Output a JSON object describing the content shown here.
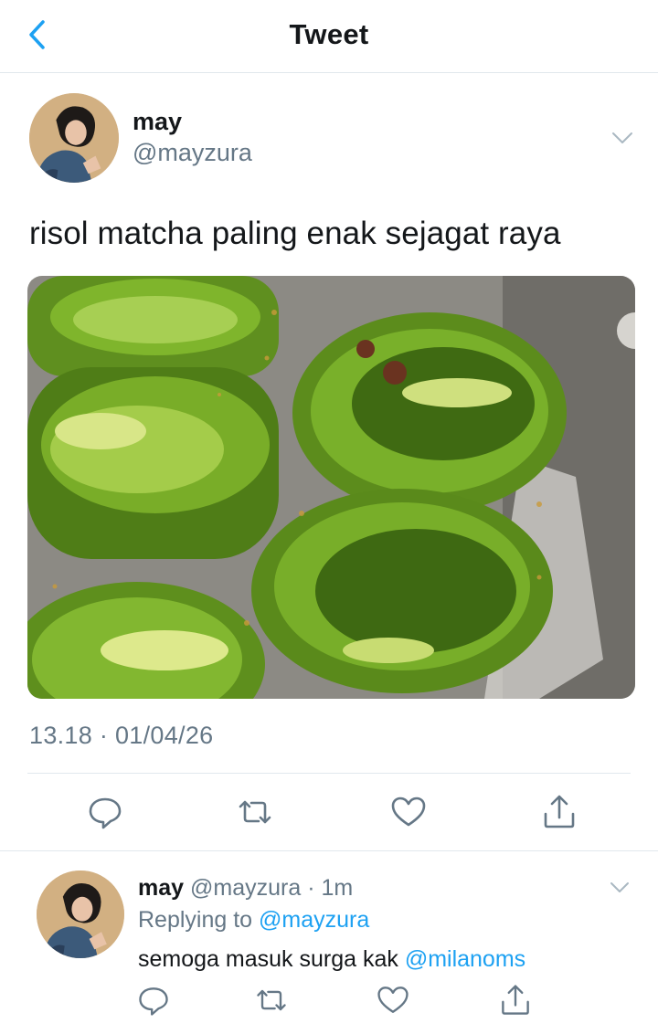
{
  "header": {
    "title": "Tweet",
    "back_icon": "chevron-left-icon"
  },
  "tweet": {
    "name": "may",
    "handle": "@mayzura",
    "text": "risol matcha paling enak sejagat raya",
    "image_subject": "fried green matcha rolls",
    "timestamp": "13.18 · 01/04/26",
    "actions": [
      "reply-icon",
      "retweet-icon",
      "like-icon",
      "share-icon"
    ]
  },
  "reply": {
    "name": "may",
    "handle": "@mayzura",
    "time": "· 1m",
    "replying_prefix": "Replying to",
    "replying_to": "@mayzura",
    "text": "semoga masuk surga kak",
    "mention": "@milanoms"
  },
  "colors": {
    "accent": "#1da1f2",
    "secondary": "#657786",
    "text": "#14171a",
    "divider": "#e1e8ed"
  }
}
